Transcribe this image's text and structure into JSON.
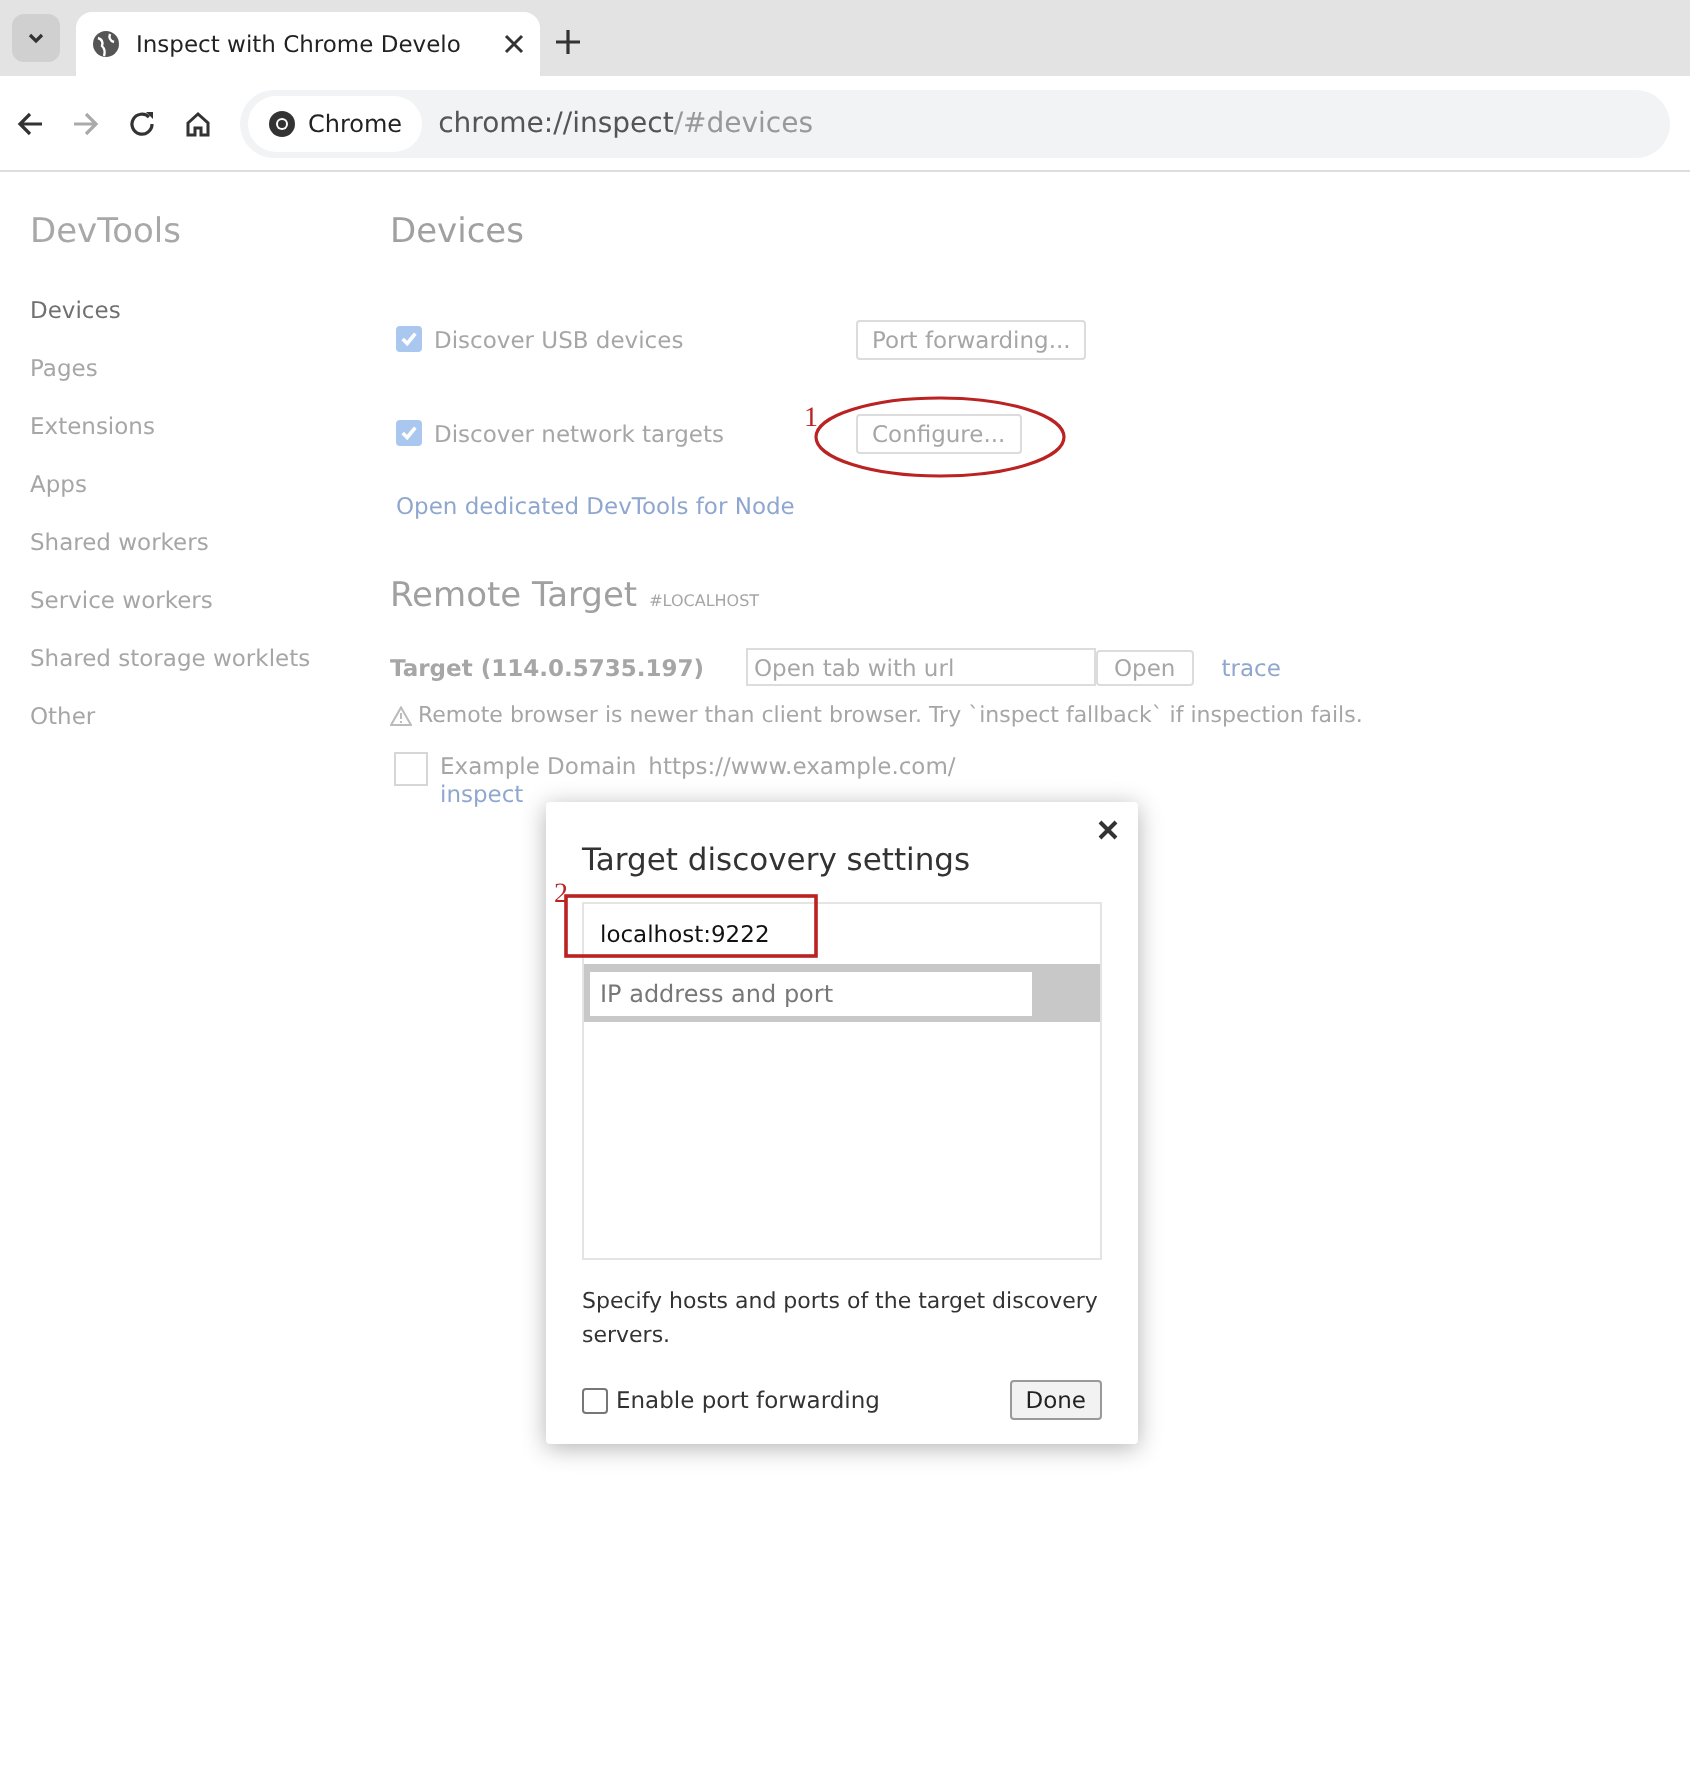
{
  "browser": {
    "tab": {
      "title": "Inspect with Chrome Develo",
      "selected": true
    },
    "chip": "Chrome",
    "url_host": "chrome://inspect",
    "url_rest": "/#devices"
  },
  "sidebar": {
    "title": "DevTools",
    "items": [
      {
        "label": "Devices",
        "selected": true
      },
      {
        "label": "Pages",
        "selected": false
      },
      {
        "label": "Extensions",
        "selected": false
      },
      {
        "label": "Apps",
        "selected": false
      },
      {
        "label": "Shared workers",
        "selected": false
      },
      {
        "label": "Service workers",
        "selected": false
      },
      {
        "label": "Shared storage worklets",
        "selected": false
      },
      {
        "label": "Other",
        "selected": false
      }
    ]
  },
  "devices": {
    "title": "Devices",
    "options": [
      {
        "label": "Discover USB devices",
        "checked": true,
        "button": "Port forwarding..."
      },
      {
        "label": "Discover network targets",
        "checked": true,
        "button": "Configure..."
      }
    ],
    "node_link": "Open dedicated DevTools for Node"
  },
  "remote": {
    "title": "Remote Target",
    "tag": "#LOCALHOST",
    "target": "Target (114.0.5735.197)",
    "url_placeholder": "Open tab with url",
    "open_button": "Open",
    "trace": "trace",
    "warning": "Remote browser is newer than client browser. Try `inspect fallback` if inspection fails.",
    "page": {
      "checked": false,
      "title": "Example Domain",
      "url": "https://www.example.com/",
      "action": "inspect"
    }
  },
  "dialog": {
    "title": "Target discovery settings",
    "entries": [
      {
        "value": "localhost:9222",
        "selected": false
      }
    ],
    "new_entry_placeholder": "IP address and port",
    "hint": "Specify hosts and ports of the target discovery servers.",
    "forwarding": {
      "label": "Enable port forwarding",
      "checked": false
    },
    "done": "Done"
  },
  "annotations": [
    {
      "label": "1",
      "kind": "ellipse"
    },
    {
      "label": "2",
      "kind": "rect"
    }
  ]
}
